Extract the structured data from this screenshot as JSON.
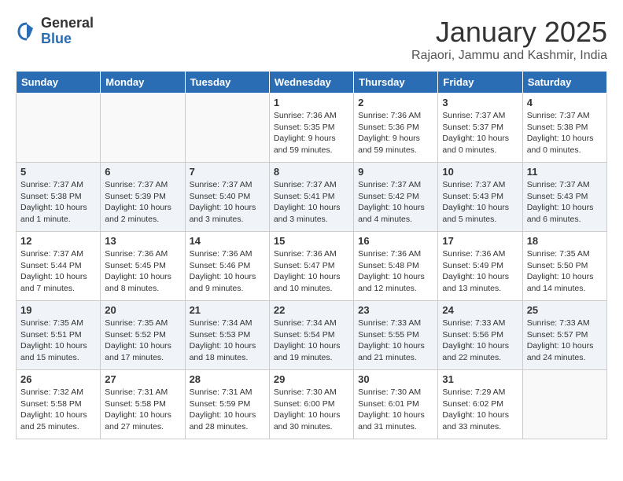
{
  "header": {
    "logo_general": "General",
    "logo_blue": "Blue",
    "month_title": "January 2025",
    "subtitle": "Rajaori, Jammu and Kashmir, India"
  },
  "weekdays": [
    "Sunday",
    "Monday",
    "Tuesday",
    "Wednesday",
    "Thursday",
    "Friday",
    "Saturday"
  ],
  "weeks": [
    [
      {
        "day": "",
        "info": ""
      },
      {
        "day": "",
        "info": ""
      },
      {
        "day": "",
        "info": ""
      },
      {
        "day": "1",
        "info": "Sunrise: 7:36 AM\nSunset: 5:35 PM\nDaylight: 9 hours\nand 59 minutes."
      },
      {
        "day": "2",
        "info": "Sunrise: 7:36 AM\nSunset: 5:36 PM\nDaylight: 9 hours\nand 59 minutes."
      },
      {
        "day": "3",
        "info": "Sunrise: 7:37 AM\nSunset: 5:37 PM\nDaylight: 10 hours\nand 0 minutes."
      },
      {
        "day": "4",
        "info": "Sunrise: 7:37 AM\nSunset: 5:38 PM\nDaylight: 10 hours\nand 0 minutes."
      }
    ],
    [
      {
        "day": "5",
        "info": "Sunrise: 7:37 AM\nSunset: 5:38 PM\nDaylight: 10 hours\nand 1 minute."
      },
      {
        "day": "6",
        "info": "Sunrise: 7:37 AM\nSunset: 5:39 PM\nDaylight: 10 hours\nand 2 minutes."
      },
      {
        "day": "7",
        "info": "Sunrise: 7:37 AM\nSunset: 5:40 PM\nDaylight: 10 hours\nand 3 minutes."
      },
      {
        "day": "8",
        "info": "Sunrise: 7:37 AM\nSunset: 5:41 PM\nDaylight: 10 hours\nand 3 minutes."
      },
      {
        "day": "9",
        "info": "Sunrise: 7:37 AM\nSunset: 5:42 PM\nDaylight: 10 hours\nand 4 minutes."
      },
      {
        "day": "10",
        "info": "Sunrise: 7:37 AM\nSunset: 5:43 PM\nDaylight: 10 hours\nand 5 minutes."
      },
      {
        "day": "11",
        "info": "Sunrise: 7:37 AM\nSunset: 5:43 PM\nDaylight: 10 hours\nand 6 minutes."
      }
    ],
    [
      {
        "day": "12",
        "info": "Sunrise: 7:37 AM\nSunset: 5:44 PM\nDaylight: 10 hours\nand 7 minutes."
      },
      {
        "day": "13",
        "info": "Sunrise: 7:36 AM\nSunset: 5:45 PM\nDaylight: 10 hours\nand 8 minutes."
      },
      {
        "day": "14",
        "info": "Sunrise: 7:36 AM\nSunset: 5:46 PM\nDaylight: 10 hours\nand 9 minutes."
      },
      {
        "day": "15",
        "info": "Sunrise: 7:36 AM\nSunset: 5:47 PM\nDaylight: 10 hours\nand 10 minutes."
      },
      {
        "day": "16",
        "info": "Sunrise: 7:36 AM\nSunset: 5:48 PM\nDaylight: 10 hours\nand 12 minutes."
      },
      {
        "day": "17",
        "info": "Sunrise: 7:36 AM\nSunset: 5:49 PM\nDaylight: 10 hours\nand 13 minutes."
      },
      {
        "day": "18",
        "info": "Sunrise: 7:35 AM\nSunset: 5:50 PM\nDaylight: 10 hours\nand 14 minutes."
      }
    ],
    [
      {
        "day": "19",
        "info": "Sunrise: 7:35 AM\nSunset: 5:51 PM\nDaylight: 10 hours\nand 15 minutes."
      },
      {
        "day": "20",
        "info": "Sunrise: 7:35 AM\nSunset: 5:52 PM\nDaylight: 10 hours\nand 17 minutes."
      },
      {
        "day": "21",
        "info": "Sunrise: 7:34 AM\nSunset: 5:53 PM\nDaylight: 10 hours\nand 18 minutes."
      },
      {
        "day": "22",
        "info": "Sunrise: 7:34 AM\nSunset: 5:54 PM\nDaylight: 10 hours\nand 19 minutes."
      },
      {
        "day": "23",
        "info": "Sunrise: 7:33 AM\nSunset: 5:55 PM\nDaylight: 10 hours\nand 21 minutes."
      },
      {
        "day": "24",
        "info": "Sunrise: 7:33 AM\nSunset: 5:56 PM\nDaylight: 10 hours\nand 22 minutes."
      },
      {
        "day": "25",
        "info": "Sunrise: 7:33 AM\nSunset: 5:57 PM\nDaylight: 10 hours\nand 24 minutes."
      }
    ],
    [
      {
        "day": "26",
        "info": "Sunrise: 7:32 AM\nSunset: 5:58 PM\nDaylight: 10 hours\nand 25 minutes."
      },
      {
        "day": "27",
        "info": "Sunrise: 7:31 AM\nSunset: 5:58 PM\nDaylight: 10 hours\nand 27 minutes."
      },
      {
        "day": "28",
        "info": "Sunrise: 7:31 AM\nSunset: 5:59 PM\nDaylight: 10 hours\nand 28 minutes."
      },
      {
        "day": "29",
        "info": "Sunrise: 7:30 AM\nSunset: 6:00 PM\nDaylight: 10 hours\nand 30 minutes."
      },
      {
        "day": "30",
        "info": "Sunrise: 7:30 AM\nSunset: 6:01 PM\nDaylight: 10 hours\nand 31 minutes."
      },
      {
        "day": "31",
        "info": "Sunrise: 7:29 AM\nSunset: 6:02 PM\nDaylight: 10 hours\nand 33 minutes."
      },
      {
        "day": "",
        "info": ""
      }
    ]
  ]
}
